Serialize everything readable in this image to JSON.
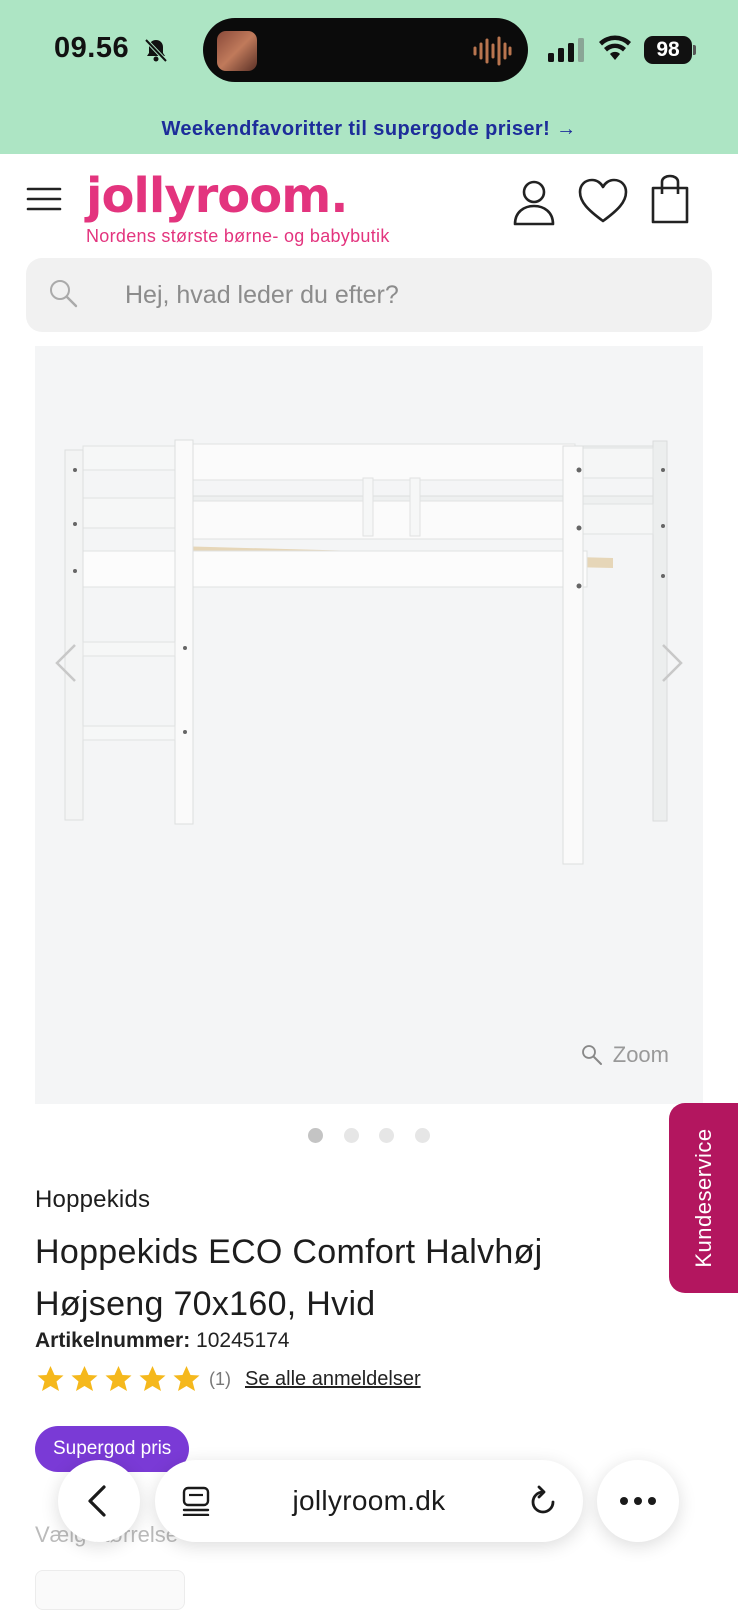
{
  "status_bar": {
    "time": "09.56",
    "battery": "98"
  },
  "promo": {
    "text": "Weekendfavoritter til supergode priser! →"
  },
  "header": {
    "logo": "jollyroom.",
    "tagline": "Nordens største børne- og babybutik"
  },
  "search": {
    "placeholder": "Hej, hvad leder du efter?"
  },
  "gallery": {
    "zoom_label": "Zoom",
    "image_count": 4,
    "active_index": 0
  },
  "product": {
    "brand": "Hoppekids",
    "title": "Hoppekids ECO Comfort Halvhøj Højseng 70x160, Hvid",
    "article_label": "Artikelnummer:",
    "article_number": "10245174",
    "rating": 5,
    "rating_count": "(1)",
    "reviews_link": "Se alle anmeldelser",
    "badge": "Supergod pris",
    "size_label": "Vælg størrelse"
  },
  "side_tab": {
    "label": "Kundeservice"
  },
  "browser": {
    "url": "jollyroom.dk"
  },
  "colors": {
    "brand_pink": "#e3347e",
    "promo_bg": "#ade5c4",
    "promo_text": "#1d2d9a",
    "side_tab_bg": "#b3165f",
    "badge_bg": "#7a3ad6",
    "star": "#f5b81c"
  }
}
